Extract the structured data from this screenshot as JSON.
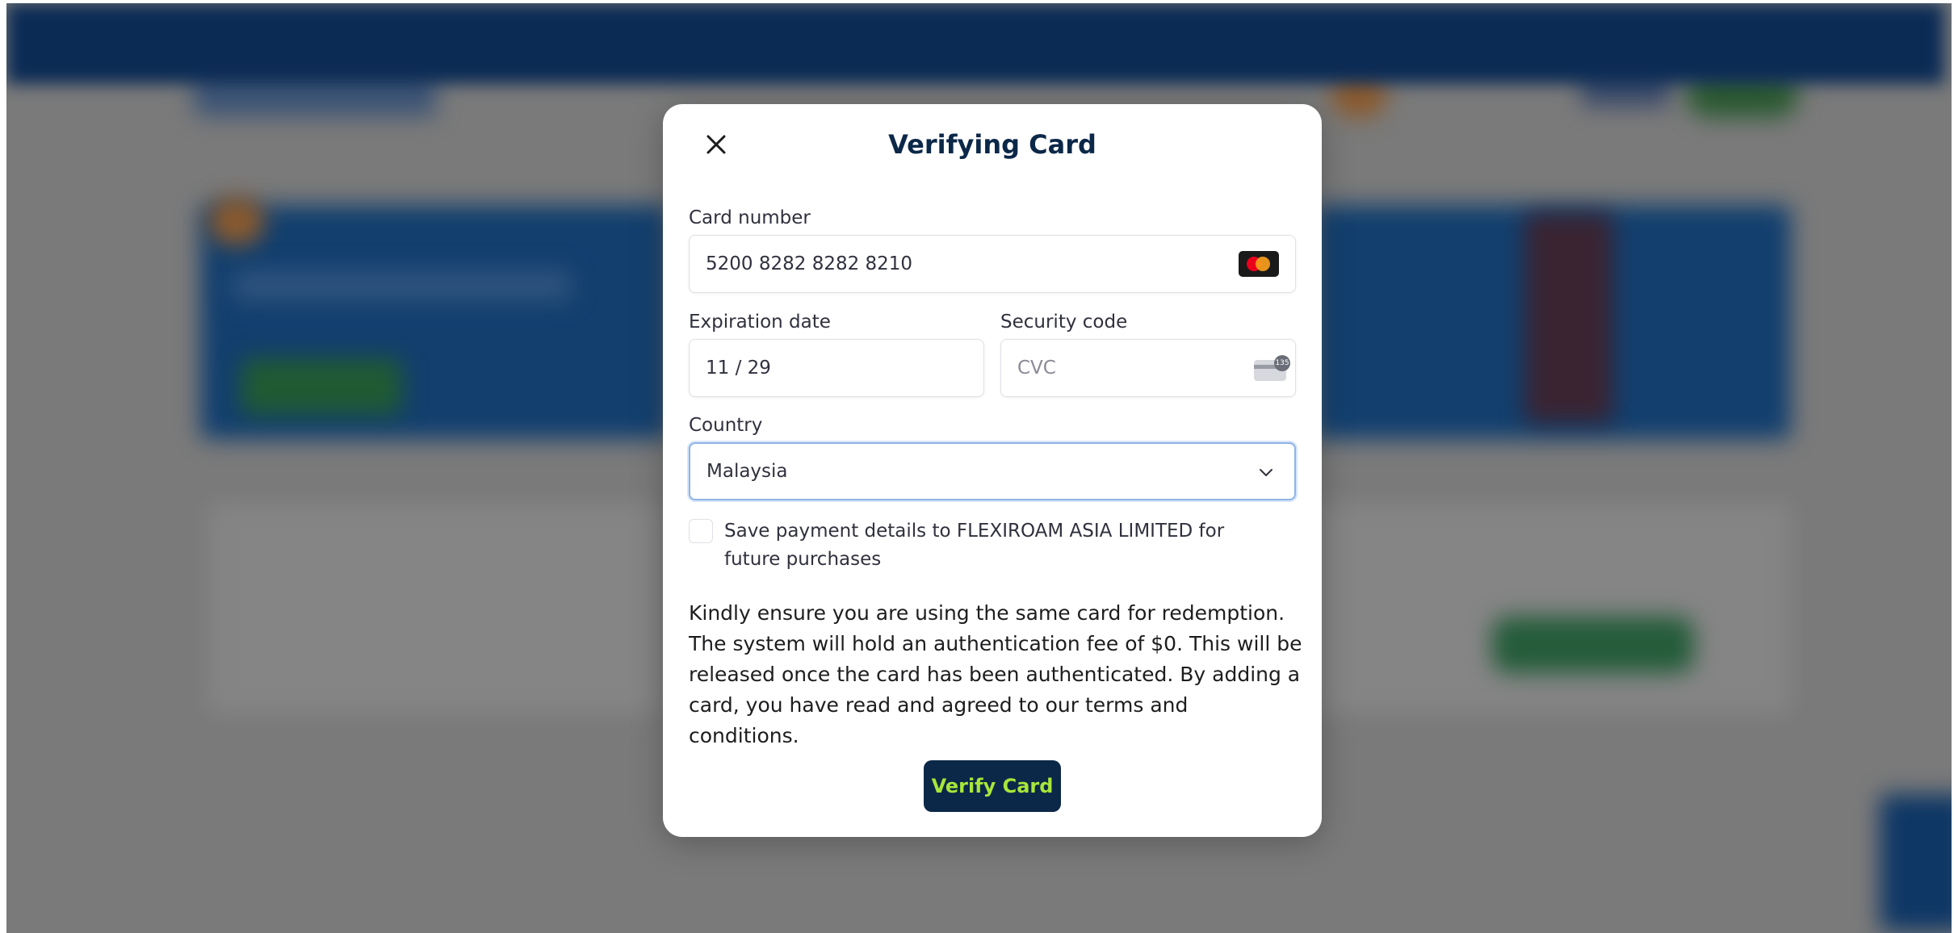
{
  "modal": {
    "title": "Verifying Card",
    "close_icon": "close-icon"
  },
  "card_number": {
    "label": "Card number",
    "value": "5200 8282 8282 8210",
    "brand_icon": "mastercard-icon"
  },
  "expiration": {
    "label": "Expiration date",
    "value": "11 / 29"
  },
  "security_code": {
    "label": "Security code",
    "placeholder": "CVC",
    "icon": "cvc-card-icon",
    "icon_badge": "135"
  },
  "country": {
    "label": "Country",
    "selected": "Malaysia",
    "icon": "chevron-down-icon"
  },
  "save_details": {
    "checked": false,
    "label": "Save payment details to FLEXIROAM ASIA LIMITED for future purchases"
  },
  "notice": "Kindly ensure you are using the same card for redemption. The system will hold an authentication fee of $0. This will be released once the card has been authenticated. By adding a card, you have read and agreed to our terms and conditions.",
  "verify_button": {
    "label": "Verify Card"
  },
  "colors": {
    "title": "#0c2848",
    "button_bg": "#0c2848",
    "button_text": "#a8e63a",
    "focus_border": "#8fb4e8"
  }
}
